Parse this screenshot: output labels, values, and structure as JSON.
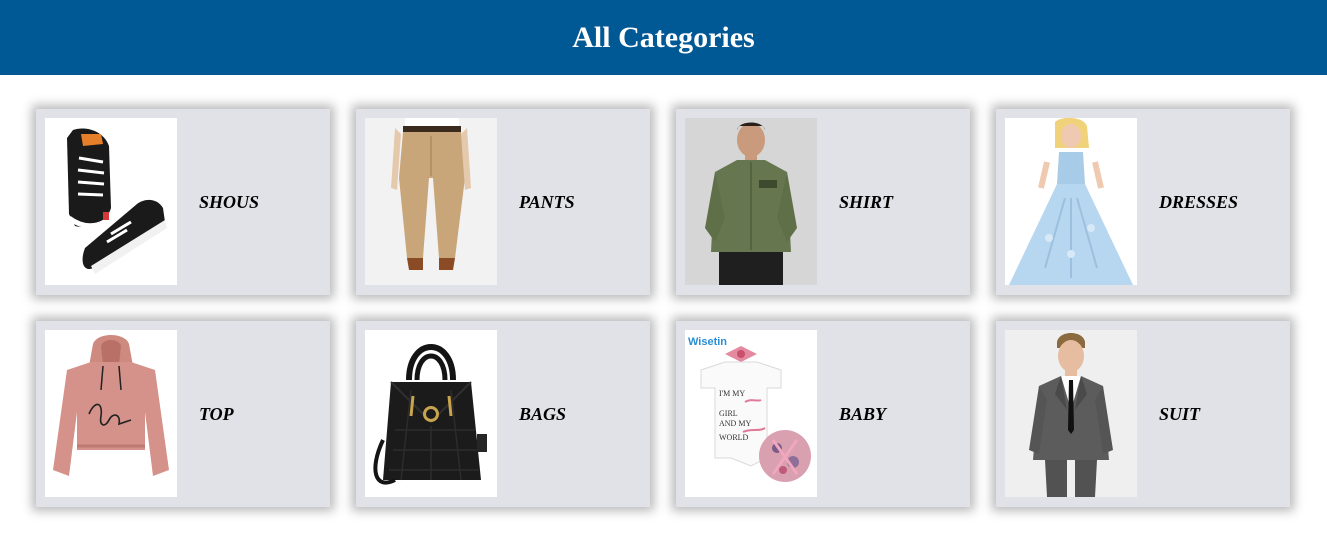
{
  "header": {
    "title": "All Categories"
  },
  "colors": {
    "header_bg": "#005895",
    "card_bg": "#e0e2e7"
  },
  "categories": [
    {
      "label": "SHOUS",
      "icon": "sneakers-icon"
    },
    {
      "label": "PANTS",
      "icon": "pants-icon"
    },
    {
      "label": "SHIRT",
      "icon": "shirt-icon"
    },
    {
      "label": "DRESSES",
      "icon": "dress-icon"
    },
    {
      "label": "TOP",
      "icon": "hoodie-icon"
    },
    {
      "label": "BAGS",
      "icon": "handbag-icon"
    },
    {
      "label": "BABY",
      "icon": "baby-outfit-icon",
      "brand": "Wisetin",
      "print_lines": [
        "I'M MY",
        "GIRL",
        "AND MY",
        "WORLD"
      ]
    },
    {
      "label": "SUIT",
      "icon": "suit-icon"
    }
  ]
}
